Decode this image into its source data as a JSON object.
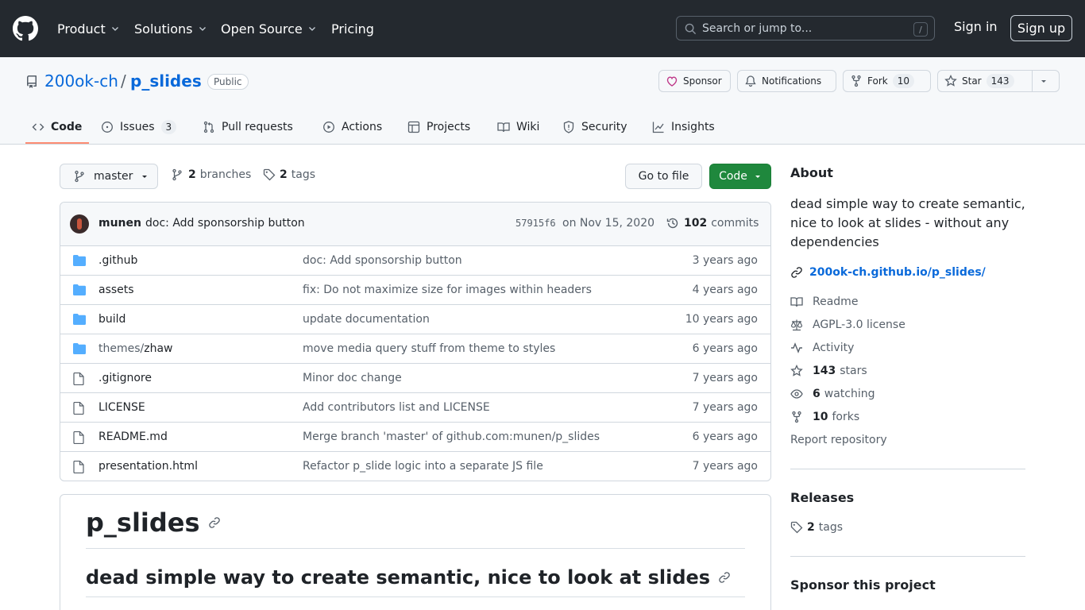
{
  "header": {
    "nav": [
      {
        "label": "Product"
      },
      {
        "label": "Solutions"
      },
      {
        "label": "Open Source"
      },
      {
        "label": "Pricing"
      }
    ],
    "search_placeholder": "Search or jump to...",
    "search_shortcut": "/",
    "signin": "Sign in",
    "signup": "Sign up"
  },
  "repo": {
    "owner": "200ok-ch",
    "separator": "/",
    "name": "p_slides",
    "visibility": "Public",
    "sponsor": "Sponsor",
    "notifications": "Notifications",
    "fork_label": "Fork",
    "fork_count": "10",
    "star_label": "Star",
    "star_count": "143"
  },
  "tabs": [
    {
      "label": "Code"
    },
    {
      "label": "Issues",
      "count": "3"
    },
    {
      "label": "Pull requests"
    },
    {
      "label": "Actions"
    },
    {
      "label": "Projects"
    },
    {
      "label": "Wiki"
    },
    {
      "label": "Security"
    },
    {
      "label": "Insights"
    }
  ],
  "branchbar": {
    "branch": "master",
    "branches_count": "2",
    "branches_label": "branches",
    "tags_count": "2",
    "tags_label": "tags",
    "goto_file": "Go to file",
    "code_button": "Code"
  },
  "last_commit": {
    "author": "munen",
    "message": "doc: Add sponsorship button",
    "sha": "57915f6",
    "date": "on Nov 15, 2020",
    "commits_count": "102",
    "commits_label": "commits"
  },
  "files": [
    {
      "type": "dir",
      "name": ".github",
      "message": "doc: Add sponsorship button",
      "age": "3 years ago"
    },
    {
      "type": "dir",
      "name": "assets",
      "message": "fix: Do not maximize size for images within headers",
      "age": "4 years ago"
    },
    {
      "type": "dir",
      "name": "build",
      "message": "update documentation",
      "age": "10 years ago"
    },
    {
      "type": "dir",
      "prefix": "themes/",
      "name": "zhaw",
      "message": "move media query stuff from theme to styles",
      "age": "6 years ago"
    },
    {
      "type": "file",
      "name": ".gitignore",
      "message": "Minor doc change",
      "age": "7 years ago"
    },
    {
      "type": "file",
      "name": "LICENSE",
      "message": "Add contributors list and LICENSE",
      "age": "7 years ago"
    },
    {
      "type": "file",
      "name": "README.md",
      "message": "Merge branch 'master' of github.com:munen/p_slides",
      "age": "6 years ago"
    },
    {
      "type": "file",
      "name": "presentation.html",
      "message": "Refactor p_slide logic into a separate JS file",
      "age": "7 years ago"
    }
  ],
  "readme": {
    "h1": "p_slides",
    "h2": "dead simple way to create semantic, nice to look at slides"
  },
  "about": {
    "title": "About",
    "description": "dead simple way to create semantic, nice to look at slides - without any dependencies",
    "website": "200ok-ch.github.io/p_slides/",
    "readme": "Readme",
    "license": "AGPL-3.0 license",
    "activity": "Activity",
    "stars_count": "143",
    "stars_label": "stars",
    "watching_count": "6",
    "watching_label": "watching",
    "forks_count": "10",
    "forks_label": "forks",
    "report": "Report repository"
  },
  "releases": {
    "title": "Releases",
    "tags_count": "2",
    "tags_label": "tags"
  },
  "sponsor_section": {
    "title": "Sponsor this project"
  },
  "colors": {
    "header_bg": "#24292f",
    "link": "#0969da",
    "green_button": "#1f883d",
    "active_tab_underline": "#fd8c73",
    "folder": "#54aeff"
  }
}
